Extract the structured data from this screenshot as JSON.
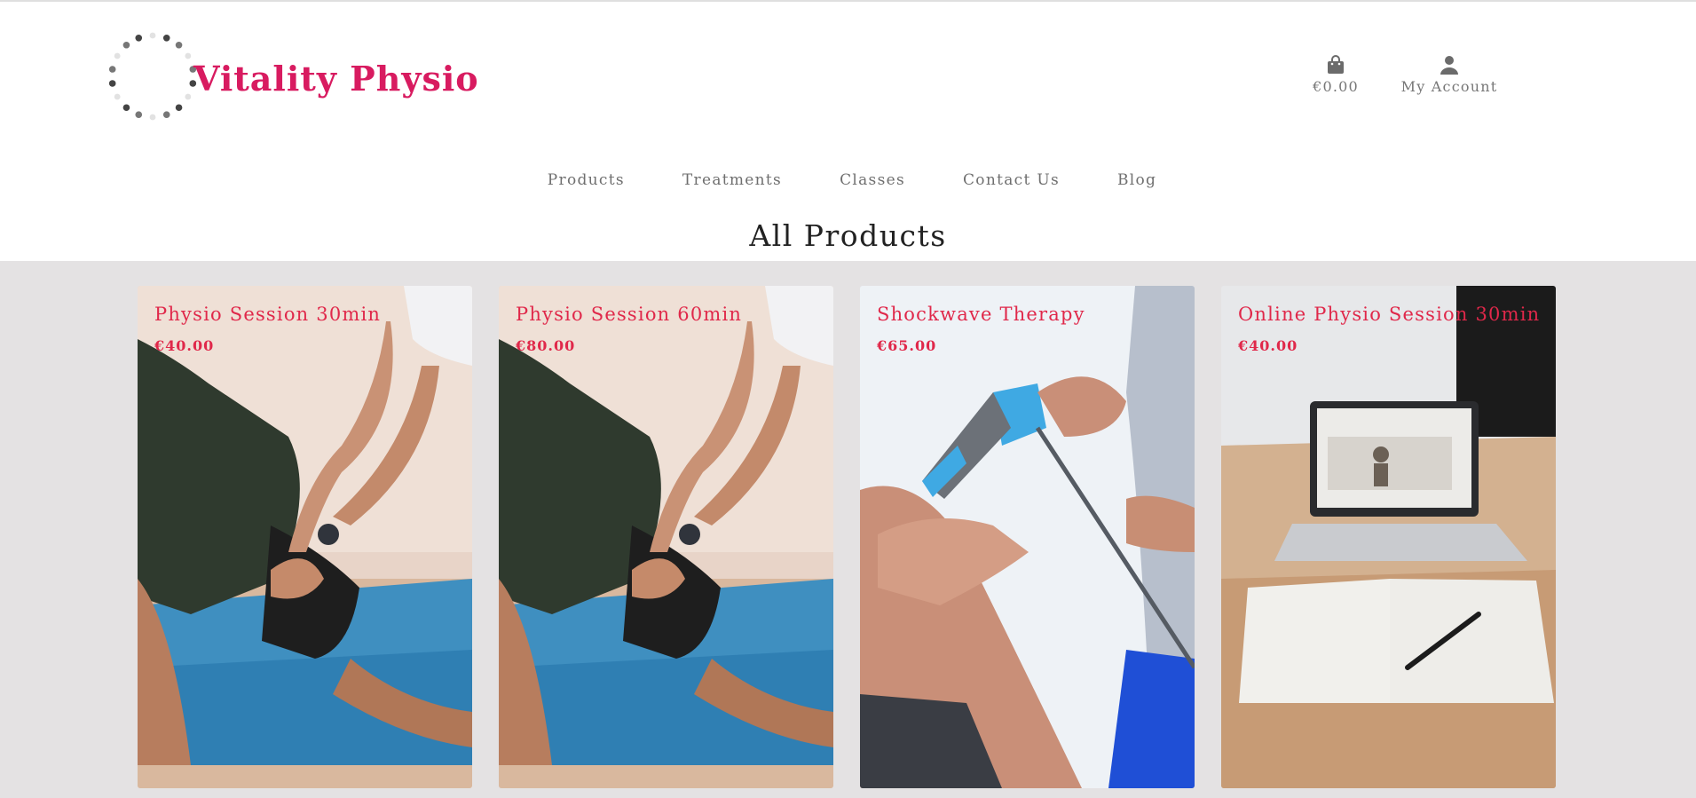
{
  "brand": {
    "name": "Vitality Physio",
    "color": "#d81b60"
  },
  "header": {
    "cart": {
      "icon": "shopping-bag-icon",
      "total": "€0.00"
    },
    "account": {
      "icon": "user-icon",
      "label": "My Account"
    }
  },
  "nav": {
    "items": [
      {
        "label": "Products"
      },
      {
        "label": "Treatments"
      },
      {
        "label": "Classes"
      },
      {
        "label": "Contact Us"
      },
      {
        "label": "Blog"
      }
    ]
  },
  "page": {
    "title": "All Products"
  },
  "products": [
    {
      "name": "Physio Session 30min",
      "price": "€40.00",
      "image": "physio-stretch-photo"
    },
    {
      "name": "Physio Session 60min",
      "price": "€80.00",
      "image": "physio-stretch-photo"
    },
    {
      "name": "Shockwave Therapy",
      "price": "€65.00",
      "image": "shockwave-knee-photo"
    },
    {
      "name": "Online Physio Session 30min",
      "price": "€40.00",
      "image": "laptop-notebook-photo"
    }
  ],
  "colors": {
    "accent": "#e0284a",
    "products_bg": "#e4e2e3",
    "nav_text": "#6f6f6f"
  }
}
